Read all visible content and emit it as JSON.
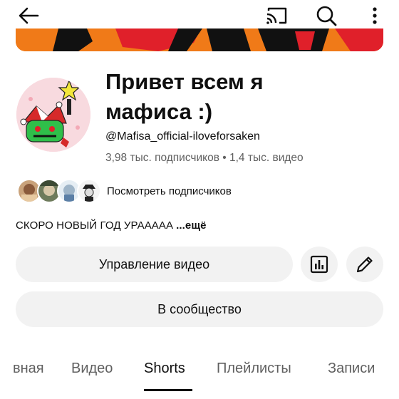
{
  "header": {
    "back_icon": "arrow-left-icon",
    "cast_icon": "cast-icon",
    "search_icon": "search-icon",
    "more_icon": "more-vertical-icon"
  },
  "channel": {
    "title": "Привет всем я мафиса :)",
    "handle": "@Mafisa_official-iloveforsaken",
    "stats": "3,98 тыс. подписчиков • 1,4 тыс. видео"
  },
  "subscribers": {
    "label": "Посмотреть подписчиков"
  },
  "description": {
    "text": "СКОРО НОВЫЙ ГОД УРААААА",
    "more": "...ещё"
  },
  "actions": {
    "manage_label": "Управление видео",
    "analytics_icon": "analytics-icon",
    "edit_icon": "pencil-icon",
    "community_label": "В сообщество"
  },
  "tabs": [
    {
      "label": "вная"
    },
    {
      "label": "Видео"
    },
    {
      "label": "Shorts",
      "active": true
    },
    {
      "label": "Плейлисты"
    },
    {
      "label": "Записи"
    }
  ],
  "colors": {
    "text": "#0f0f0f",
    "secondary_text": "#606060",
    "button_bg": "#f2f2f2",
    "banner_orange": "#f07a18"
  }
}
